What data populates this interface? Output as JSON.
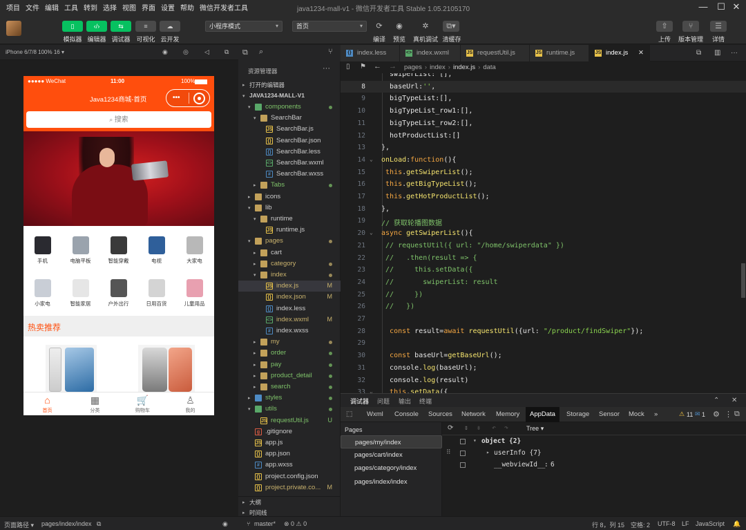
{
  "menu": [
    "项目",
    "文件",
    "编辑",
    "工具",
    "转到",
    "选择",
    "视图",
    "界面",
    "设置",
    "帮助",
    "微信开发者工具"
  ],
  "window_title": "java1234-mall-v1 - 微信开发者工具 Stable 1.05.2105170",
  "toolbar": {
    "simulator": "模拟器",
    "editor": "编辑器",
    "debugger": "调试器",
    "visual": "可视化",
    "cloud": "云开发",
    "mode_select": "小程序模式",
    "page_select": "首页",
    "compile": "编译",
    "preview": "预览",
    "real_debug": "真机调试",
    "clear_cache": "清缓存",
    "upload": "上传",
    "version": "版本管理",
    "details": "详情"
  },
  "simulator": {
    "device": "iPhone 6/7/8 100% 16 ▾",
    "status_carrier": "●●●●● WeChat",
    "status_time": "11:00",
    "status_battery": "100%",
    "nav_title": "Java1234商城-首页",
    "search_placeholder": "搜索",
    "categories": [
      {
        "label": "手机",
        "color": "#2a2a30"
      },
      {
        "label": "电脑平板",
        "color": "#9aa3ad"
      },
      {
        "label": "智能穿戴",
        "color": "#3a3a3a"
      },
      {
        "label": "电视",
        "color": "#2f5f9a"
      },
      {
        "label": "大家电",
        "color": "#b8b8b8"
      },
      {
        "label": "小家电",
        "color": "#c9ced6"
      },
      {
        "label": "智能家居",
        "color": "#e6e6e6"
      },
      {
        "label": "户外出行",
        "color": "#555555"
      },
      {
        "label": "日用百货",
        "color": "#d4d4d4"
      },
      {
        "label": "儿童用品",
        "color": "#e8a0b0"
      }
    ],
    "hot_title": "热卖推荐",
    "tabs": [
      {
        "label": "首页",
        "icon": "⌂"
      },
      {
        "label": "分类",
        "icon": "▦"
      },
      {
        "label": "购物车",
        "icon": "🛒"
      },
      {
        "label": "我的",
        "icon": "♙"
      }
    ]
  },
  "explorer": {
    "title": "资源管理器",
    "open_editors": "打开的编辑器",
    "project": "JAVA1234-MALL-V1",
    "outline": "大纲",
    "timeline": "时间线"
  },
  "tree": [
    {
      "name": "components",
      "depth": 1,
      "kind": "folder-green",
      "open": true,
      "dot": true,
      "color": "#7fc36a"
    },
    {
      "name": "SearchBar",
      "depth": 2,
      "kind": "folder",
      "open": true
    },
    {
      "name": "SearchBar.js",
      "depth": 3,
      "kind": "js"
    },
    {
      "name": "SearchBar.json",
      "depth": 3,
      "kind": "json"
    },
    {
      "name": "SearchBar.less",
      "depth": 3,
      "kind": "less"
    },
    {
      "name": "SearchBar.wxml",
      "depth": 3,
      "kind": "wxml"
    },
    {
      "name": "SearchBar.wxss",
      "depth": 3,
      "kind": "wxss"
    },
    {
      "name": "Tabs",
      "depth": 2,
      "kind": "folder",
      "open": false,
      "dot": true,
      "color": "#7fc36a"
    },
    {
      "name": "icons",
      "depth": 1,
      "kind": "folder",
      "open": false
    },
    {
      "name": "lib",
      "depth": 1,
      "kind": "folder",
      "open": true
    },
    {
      "name": "runtime",
      "depth": 2,
      "kind": "folder",
      "open": true
    },
    {
      "name": "runtime.js",
      "depth": 3,
      "kind": "js"
    },
    {
      "name": "pages",
      "depth": 1,
      "kind": "folder",
      "open": true,
      "dot": true,
      "color": "#c9b26d"
    },
    {
      "name": "cart",
      "depth": 2,
      "kind": "folder",
      "open": false
    },
    {
      "name": "category",
      "depth": 2,
      "kind": "folder",
      "open": false,
      "dot": true,
      "color": "#c9b26d"
    },
    {
      "name": "index",
      "depth": 2,
      "kind": "folder",
      "open": true,
      "dot": true,
      "color": "#c9b26d"
    },
    {
      "name": "index.js",
      "depth": 3,
      "kind": "js",
      "status": "M",
      "selected": true,
      "color": "#c9b26d"
    },
    {
      "name": "index.json",
      "depth": 3,
      "kind": "json",
      "status": "M",
      "color": "#c9b26d"
    },
    {
      "name": "index.less",
      "depth": 3,
      "kind": "less"
    },
    {
      "name": "index.wxml",
      "depth": 3,
      "kind": "wxml",
      "status": "M",
      "color": "#c9b26d"
    },
    {
      "name": "index.wxss",
      "depth": 3,
      "kind": "wxss"
    },
    {
      "name": "my",
      "depth": 2,
      "kind": "folder",
      "open": false,
      "dot": true,
      "color": "#c9b26d"
    },
    {
      "name": "order",
      "depth": 2,
      "kind": "folder",
      "open": false,
      "dot": true,
      "color": "#7fc36a"
    },
    {
      "name": "pay",
      "depth": 2,
      "kind": "folder",
      "open": false,
      "dot": true,
      "color": "#7fc36a"
    },
    {
      "name": "product_detail",
      "depth": 2,
      "kind": "folder",
      "open": false,
      "dot": true,
      "color": "#7fc36a"
    },
    {
      "name": "search",
      "depth": 2,
      "kind": "folder",
      "open": false,
      "dot": true,
      "color": "#7fc36a"
    },
    {
      "name": "styles",
      "depth": 1,
      "kind": "folder-blue",
      "open": false,
      "dot": true,
      "color": "#7fc36a"
    },
    {
      "name": "utils",
      "depth": 1,
      "kind": "folder-green",
      "open": true,
      "dot": true,
      "color": "#7fc36a"
    },
    {
      "name": "requestUtil.js",
      "depth": 2,
      "kind": "js",
      "status": "U",
      "color": "#7fc36a"
    },
    {
      "name": ".gitignore",
      "depth": 1,
      "kind": "git"
    },
    {
      "name": "app.js",
      "depth": 1,
      "kind": "js"
    },
    {
      "name": "app.json",
      "depth": 1,
      "kind": "json"
    },
    {
      "name": "app.wxss",
      "depth": 1,
      "kind": "wxss"
    },
    {
      "name": "project.config.json",
      "depth": 1,
      "kind": "json"
    },
    {
      "name": "project.private.co...",
      "depth": 1,
      "kind": "json",
      "status": "M",
      "color": "#c9b26d"
    }
  ],
  "editor_tabs": [
    {
      "name": "index.less",
      "kind": "less",
      "active": false
    },
    {
      "name": "index.wxml",
      "kind": "wxml",
      "active": false
    },
    {
      "name": "requestUtil.js",
      "kind": "js",
      "active": false
    },
    {
      "name": "runtime.js",
      "kind": "js",
      "active": false
    },
    {
      "name": "index.js",
      "kind": "js",
      "active": true
    }
  ],
  "breadcrumb": [
    "pages",
    "index",
    "index.js",
    "data"
  ],
  "code_lines": [
    {
      "n": "",
      "fold": "",
      "html": "  swiperList: [],"
    },
    {
      "n": "8",
      "fold": "",
      "html": "  baseUrl:'',",
      "cur": true
    },
    {
      "n": "9",
      "fold": "",
      "html": "  bigTypeList:[],"
    },
    {
      "n": "10",
      "fold": "",
      "html": "  bigTypeList_row1:[],"
    },
    {
      "n": "11",
      "fold": "",
      "html": "  bigTypeList_row2:[],"
    },
    {
      "n": "12",
      "fold": "",
      "html": "  hotProductList:[]"
    },
    {
      "n": "13",
      "fold": "",
      "html": "},"
    },
    {
      "n": "14",
      "fold": "⌄",
      "html": "onLoad:function(){"
    },
    {
      "n": "15",
      "fold": "",
      "html": " this.getSwiperList();"
    },
    {
      "n": "16",
      "fold": "",
      "html": " this.getBigTypeList();"
    },
    {
      "n": "17",
      "fold": "",
      "html": " this.getHotProductList();"
    },
    {
      "n": "18",
      "fold": "",
      "html": "},"
    },
    {
      "n": "19",
      "fold": "",
      "html": "// 获取轮播图数据"
    },
    {
      "n": "20",
      "fold": "⌄",
      "html": "async getSwiperList(){"
    },
    {
      "n": "21",
      "fold": "",
      "html": " // requestUtil({ url: \"/home/swiperdata\" })"
    },
    {
      "n": "22",
      "fold": "",
      "html": " //   .then(result => {"
    },
    {
      "n": "23",
      "fold": "",
      "html": " //     this.setData({"
    },
    {
      "n": "24",
      "fold": "",
      "html": " //       swiperList: result"
    },
    {
      "n": "25",
      "fold": "",
      "html": " //     })"
    },
    {
      "n": "26",
      "fold": "",
      "html": " //   })"
    },
    {
      "n": "27",
      "fold": "",
      "html": ""
    },
    {
      "n": "28",
      "fold": "",
      "html": "  const result=await requestUtil({url: \"/product/findSwiper\"});"
    },
    {
      "n": "29",
      "fold": "",
      "html": ""
    },
    {
      "n": "30",
      "fold": "",
      "html": "  const baseUrl=getBaseUrl();"
    },
    {
      "n": "31",
      "fold": "",
      "html": "  console.log(baseUrl);"
    },
    {
      "n": "32",
      "fold": "",
      "html": "  console.log(result)"
    },
    {
      "n": "33",
      "fold": "⌄",
      "html": "  this.setData({"
    }
  ],
  "devtools": {
    "top_tabs": [
      "调试器",
      "问题",
      "输出",
      "终端"
    ],
    "tabs": [
      "Wxml",
      "Console",
      "Sources",
      "Network",
      "Memory",
      "AppData",
      "Storage",
      "Sensor",
      "Mock"
    ],
    "more": "»",
    "warn_count": "11",
    "err_count": "1",
    "pages_title": "Pages",
    "pages": [
      "pages/my/index",
      "pages/cart/index",
      "pages/category/index",
      "pages/index/index"
    ],
    "view_mode": "Tree",
    "data_root": "object {2}",
    "data_child1": "userInfo {7}",
    "data_child2_key": "__webviewId__",
    "data_child2_val": "6"
  },
  "status": {
    "page_path_label": "页面路径 ▾",
    "page_path": "pages/index/index",
    "branch": "master*",
    "problems": "⊗ 0 ⚠ 0",
    "cursor": "行 8，列 15",
    "spaces": "空格: 2",
    "encoding": "UTF-8",
    "eol": "LF",
    "language": "JavaScript"
  }
}
